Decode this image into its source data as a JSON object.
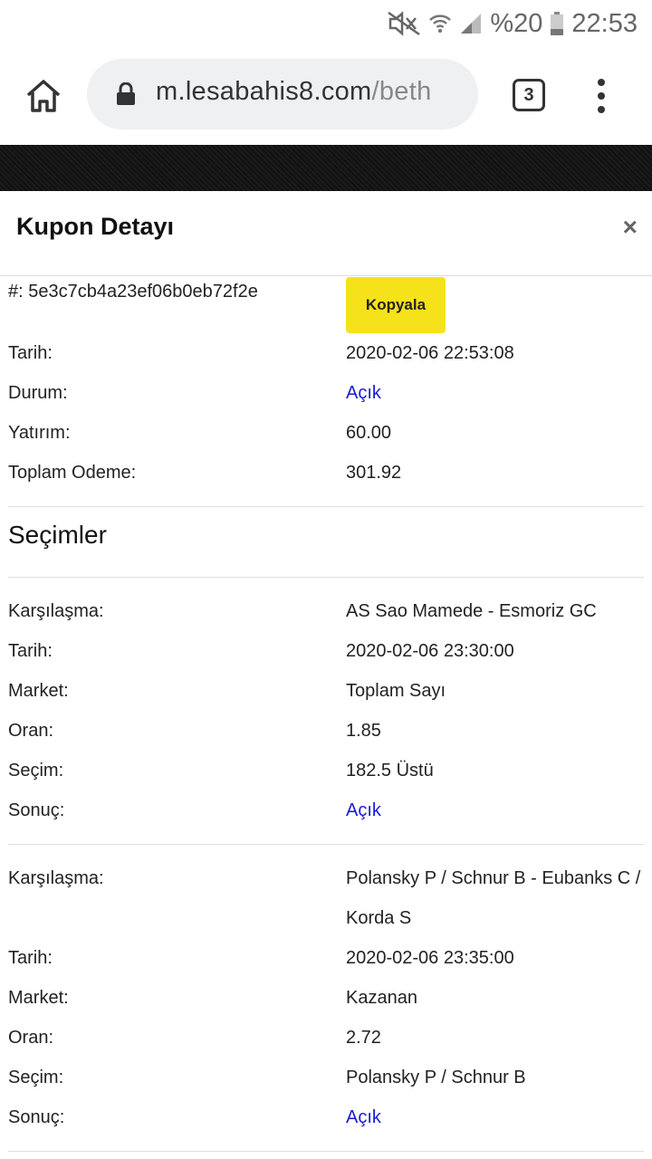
{
  "status_bar": {
    "battery": "%20",
    "time": "22:53"
  },
  "browser": {
    "url_domain": "m.lesabahis8.com",
    "url_path": "/beth",
    "tab_count": "3"
  },
  "modal": {
    "title": "Kupon Detayı",
    "close": "×",
    "hash_label": "#:",
    "hash_value": "5e3c7cb4a23ef06b0eb72f2e",
    "copy_label": "Kopyala",
    "info": [
      {
        "label": "Tarih:",
        "value": "2020-02-06 22:53:08"
      },
      {
        "label": "Durum:",
        "value": "Açık"
      },
      {
        "label": "Yatırım:",
        "value": "60.00"
      },
      {
        "label": "Toplam Odeme:",
        "value": "301.92"
      }
    ],
    "selections_title": "Seçimler",
    "selections": [
      {
        "match_label": "Karşılaşma:",
        "match": "AS Sao Mamede - Esmoriz GC",
        "date_label": "Tarih:",
        "date": "2020-02-06 23:30:00",
        "market_label": "Market:",
        "market": "Toplam Sayı",
        "odds_label": "Oran:",
        "odds": "1.85",
        "pick_label": "Seçim:",
        "pick": "182.5 Üstü",
        "result_label": "Sonuç:",
        "result": "Açık"
      },
      {
        "match_label": "Karşılaşma:",
        "match": "Polansky P / Schnur B - Eubanks C / Korda S",
        "date_label": "Tarih:",
        "date": "2020-02-06 23:35:00",
        "market_label": "Market:",
        "market": "Kazanan",
        "odds_label": "Oran:",
        "odds": "2.72",
        "pick_label": "Seçim:",
        "pick": "Polansky P / Schnur B",
        "result_label": "Sonuç:",
        "result": "Açık"
      }
    ]
  },
  "colors": {
    "accent_yellow": "#f5e21b",
    "link_blue": "#1a1ad4"
  }
}
